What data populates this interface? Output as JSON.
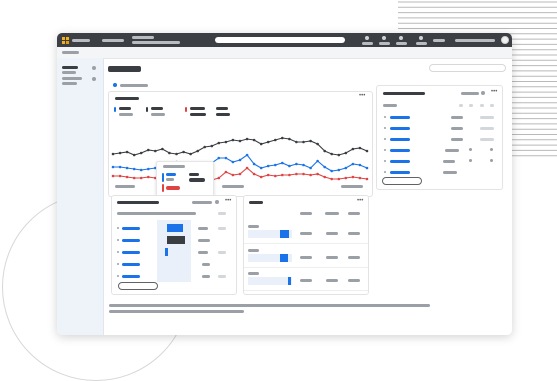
{
  "colors": {
    "accent_blue": "#1a73e8",
    "series_dark": "#3a3d41",
    "series_red": "#e04343",
    "topbar": "#3c3f44",
    "sidebar": "#eef3fa"
  },
  "icons": {
    "app": "grid-icon",
    "more": "more-horiz-icon",
    "user": "avatar-icon",
    "toolbar": [
      "notification-icon",
      "help-icon",
      "settings-icon",
      "apps-icon"
    ]
  },
  "dashboard": {
    "trend_chart": {
      "series_colors": [
        "#3a3d41",
        "#1a73e8",
        "#e04343"
      ]
    },
    "more_menu_glyph": "•••"
  }
}
